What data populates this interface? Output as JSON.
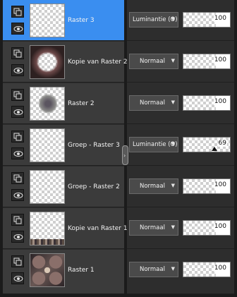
{
  "layers": [
    {
      "name": "Raster 3",
      "blend": "Luminantie (O)",
      "opacity": "100",
      "selected": true
    },
    {
      "name": "Kopie van Raster 2",
      "blend": "Normaal",
      "opacity": "100",
      "selected": false
    },
    {
      "name": "Raster 2",
      "blend": "Normaal",
      "opacity": "100",
      "selected": false
    },
    {
      "name": "Groep - Raster 3",
      "blend": "Luminantie (O)",
      "opacity": "69",
      "selected": false
    },
    {
      "name": "Groep - Raster 2",
      "blend": "Normaal",
      "opacity": "100",
      "selected": false
    },
    {
      "name": "Kopie van Raster 1",
      "blend": "Normaal",
      "opacity": "100",
      "selected": false
    },
    {
      "name": "Raster 1",
      "blend": "Normaal",
      "opacity": "100",
      "selected": false
    }
  ],
  "icons": {
    "lock": "layer-lock-icon",
    "visibility": "eye-icon",
    "dropdown": "chevron-down-icon",
    "splitter": "chevron-right-icon"
  },
  "colors": {
    "selected_row": "#3a8ef0",
    "row": "#3b3b3b",
    "panel": "#2d2d2d"
  }
}
